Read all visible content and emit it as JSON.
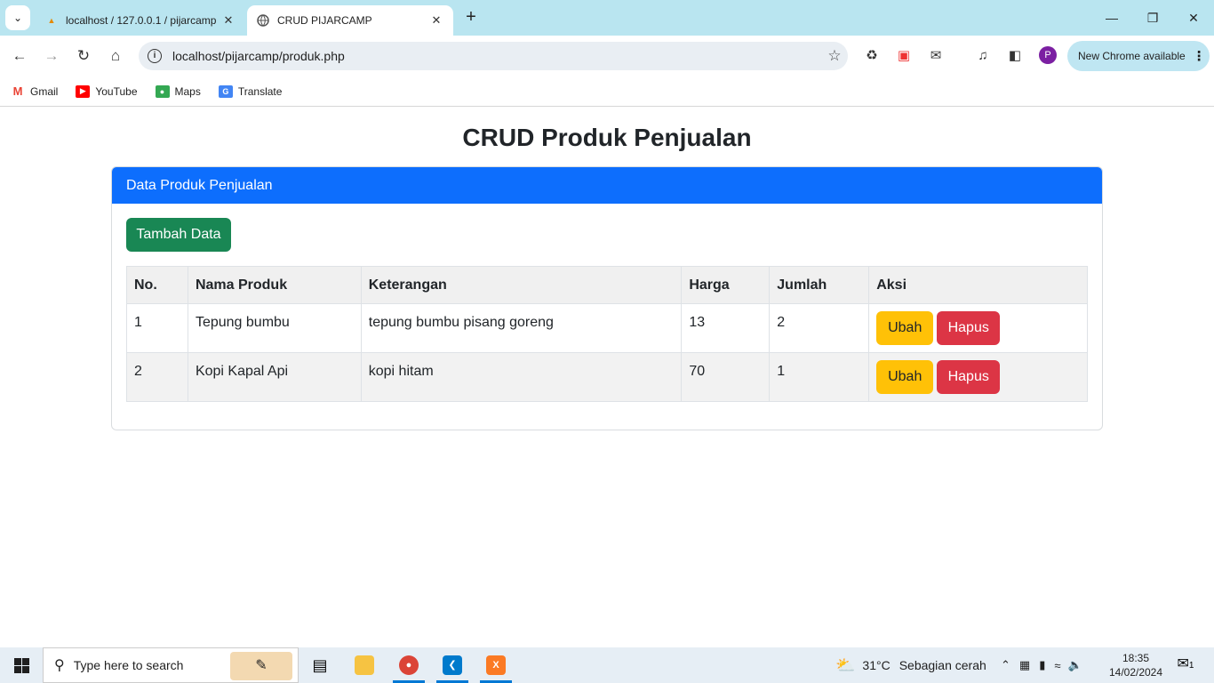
{
  "browser": {
    "tabs": [
      {
        "title": "localhost / 127.0.0.1 / pijarcamp",
        "favicon": "phpmyadmin-icon"
      },
      {
        "title": "CRUD PIJARCAMP",
        "favicon": "globe-icon"
      }
    ],
    "url": "localhost/pijarcamp/produk.php",
    "new_chrome_label": "New Chrome available",
    "profile_initial": "P",
    "bookmarks": [
      "Gmail",
      "YouTube",
      "Maps",
      "Translate"
    ]
  },
  "page": {
    "title": "CRUD Produk Penjualan",
    "card_header": "Data Produk Penjualan",
    "add_button": "Tambah Data",
    "table": {
      "headers": [
        "No.",
        "Nama Produk",
        "Keterangan",
        "Harga",
        "Jumlah",
        "Aksi"
      ],
      "rows": [
        {
          "no": "1",
          "nama": "Tepung bumbu",
          "keterangan": "tepung bumbu pisang goreng",
          "harga": "13",
          "jumlah": "2"
        },
        {
          "no": "2",
          "nama": "Kopi Kapal Api",
          "keterangan": "kopi hitam",
          "harga": "70",
          "jumlah": "1"
        }
      ],
      "edit_label": "Ubah",
      "delete_label": "Hapus"
    }
  },
  "taskbar": {
    "search_placeholder": "Type here to search",
    "weather_temp": "31°C",
    "weather_text": "Sebagian cerah",
    "time": "18:35",
    "date": "14/02/2024",
    "notification_count": "1"
  },
  "colors": {
    "primary": "#0d6efd",
    "success": "#198754",
    "warning": "#ffc107",
    "danger": "#dc3545"
  }
}
